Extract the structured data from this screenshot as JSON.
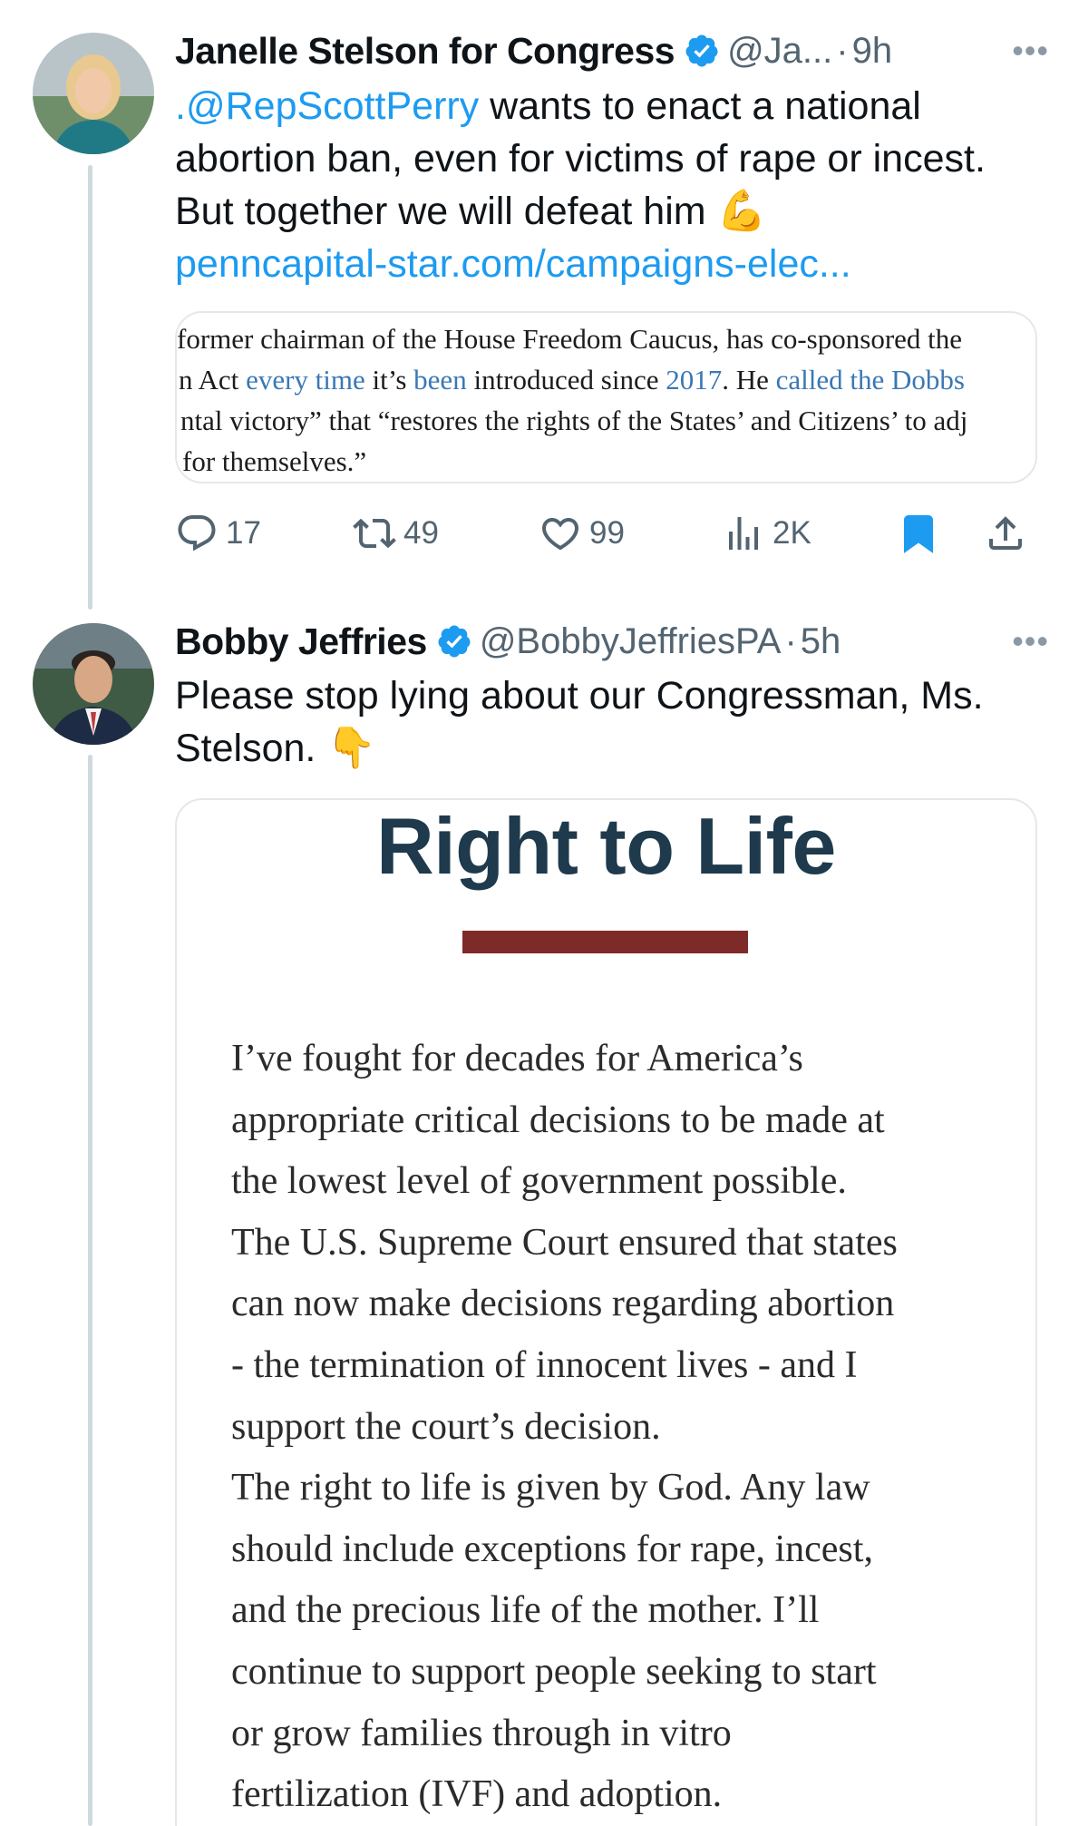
{
  "tweet1": {
    "author_name": "Janelle Stelson for Congress",
    "handle": "@Ja...",
    "separator": "·",
    "time": "9h",
    "more": "•••",
    "text_mention": ".@RepScottPerry",
    "text_line1_rest": " wants to enact a national",
    "text_line2": "abortion ban, even for victims of rape or incest.",
    "text_line3": "But together we will defeat him ",
    "emoji": "💪",
    "link": "penncapital-star.com/campaigns-elec...",
    "quote_lines": [
      {
        "parts": [
          {
            "t": "former chairman of the House Freedom Caucus, has co-sponsored the",
            "c": ""
          }
        ]
      },
      {
        "parts": [
          {
            "t": "n Act ",
            "c": ""
          },
          {
            "t": "every time",
            "c": "blue"
          },
          {
            "t": " it’s ",
            "c": ""
          },
          {
            "t": "been",
            "c": "blue"
          },
          {
            "t": " introduced since ",
            "c": ""
          },
          {
            "t": "2017",
            "c": "blue"
          },
          {
            "t": ". He ",
            "c": ""
          },
          {
            "t": "called the Dobbs",
            "c": "blue"
          }
        ]
      },
      {
        "parts": [
          {
            "t": "ntal victory”  that “restores the rights of the States’ and Citizens’ to adj",
            "c": ""
          }
        ]
      },
      {
        "parts": [
          {
            "t": "for themselves.”",
            "c": ""
          }
        ]
      }
    ],
    "actions": {
      "reply_count": "17",
      "retweet_count": "49",
      "like_count": "99",
      "view_count": "2K"
    }
  },
  "tweet2": {
    "author_name": "Bobby Jeffries",
    "handle": "@BobbyJeffriesPA",
    "separator": "·",
    "time": "5h",
    "more": "•••",
    "text_line1": "Please stop lying about our Congressman, Ms.",
    "text_line2": "Stelson. ",
    "emoji": "👇",
    "image": {
      "title": "Right to Life",
      "lines": [
        "I’ve fought for decades for America’s",
        "appropriate critical decisions to be made at",
        "the lowest level of government possible.",
        "The U.S. Supreme Court ensured that states",
        "can now make decisions regarding abortion",
        "- the termination of innocent lives - and I",
        "support the court’s decision.",
        "The right to life is given by God.  Any law",
        "should include exceptions for rape, incest,",
        "and the precious life of the mother. I’ll",
        "continue to support people seeking to start",
        "or grow families through in vitro",
        "fertilization (IVF) and adoption."
      ]
    }
  },
  "colors": {
    "link_blue": "#1d9bf0",
    "bookmark_blue": "#1d9bf0",
    "muted_gray": "#536471",
    "title_navy": "#1e3a4c",
    "divider_maroon": "#7e2a28"
  },
  "icons": {
    "reply": "reply-icon",
    "retweet": "retweet-icon",
    "like": "heart-icon",
    "views": "views-icon",
    "bookmark": "bookmark-icon",
    "share": "share-icon",
    "verified": "verified-badge-icon"
  }
}
